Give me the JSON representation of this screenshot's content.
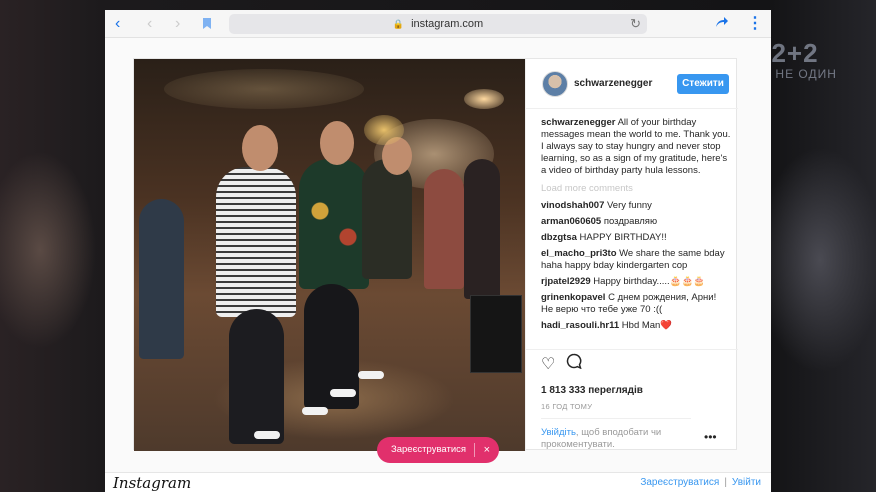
{
  "browser": {
    "url": "instagram.com"
  },
  "broadcast": {
    "logo_main": "2+2",
    "logo_slogan": "ТИ НЕ ОДИН"
  },
  "post": {
    "username": "schwarzenegger",
    "follow_label": "Стежити",
    "caption_user": "schwarzenegger",
    "caption_text": "All of your birthday messages mean the world to me. Thank you. I always say to stay hungry and never stop learning, so as a sign of my gratitude, here's a video of birthday party hula lessons.",
    "load_more": "Load more comments",
    "comments": [
      {
        "user": "vinodshah007",
        "text": "Very funny"
      },
      {
        "user": "arman060605",
        "text": "поздравляю"
      },
      {
        "user": "dbzgtsa",
        "text": "HAPPY BIRTHDAY!!"
      },
      {
        "user": "el_macho_pri3to",
        "text": "We share the same bday haha happy bday kindergarten cop"
      },
      {
        "user": "rjpatel2929",
        "text": "Happy birthday.....🎂🎂🎂"
      },
      {
        "user": "grinenkopavel",
        "text": "С днем рождения, Арни! Не верю что тебе уже 70 :(("
      },
      {
        "user": "hadi_rasouli.hr11",
        "text": "Hbd Man❤️"
      }
    ],
    "views": "1 813 333 переглядів",
    "time_ago": "16 ГОД ТОМУ",
    "login_link": "Увійдіть",
    "login_text": ", щоб вподобати чи прокоментувати.",
    "more_icon": "more-dots-icon"
  },
  "register_pill": {
    "label": "Зареєструватися",
    "close": "×"
  },
  "footer": {
    "brand": "Instagram",
    "register": "Зареєструватися",
    "separator": "|",
    "login": "Увійти"
  },
  "colors": {
    "accent": "#3897f0",
    "pill": "#e1306c"
  }
}
